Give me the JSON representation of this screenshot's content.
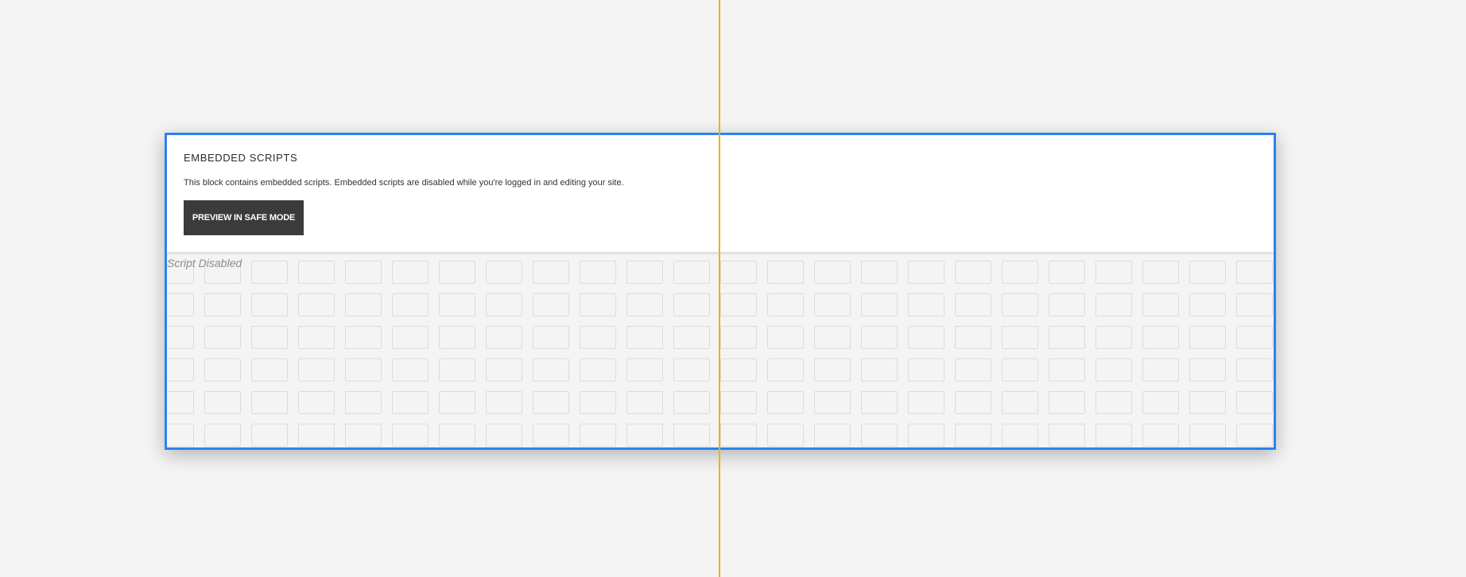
{
  "embed_block": {
    "heading": "EMBEDDED SCRIPTS",
    "message": "This block contains embedded scripts. Embedded scripts are disabled while you're logged in and editing your site.",
    "preview_button_label": "PREVIEW IN SAFE MODE",
    "placeholder_label": "Script Disabled"
  },
  "colors": {
    "selection_outline": "#2a82f0",
    "guide_line": "#f2b010",
    "button_background": "#3b3b3b",
    "page_background": "#f4f4f4"
  }
}
